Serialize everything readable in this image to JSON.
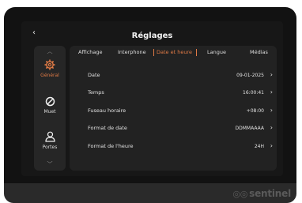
{
  "screen": {
    "title": "Réglages",
    "back_icon": "chevron-left-icon"
  },
  "sidebar": {
    "items": [
      {
        "label": "Général",
        "icon": "gear-icon",
        "active": true
      },
      {
        "label": "Muet",
        "icon": "mute-icon",
        "active": false
      },
      {
        "label": "Portes",
        "icon": "user-icon",
        "active": false
      }
    ]
  },
  "tabs": [
    {
      "label": "Affichage",
      "active": false
    },
    {
      "label": "Interphone",
      "active": false
    },
    {
      "label": "Date et heure",
      "active": true
    },
    {
      "label": "Langue",
      "active": false
    },
    {
      "label": "Médias",
      "active": false
    }
  ],
  "settings": [
    {
      "label": "Date",
      "value": "09-01-2025"
    },
    {
      "label": "Temps",
      "value": "16:00:41"
    },
    {
      "label": "Fuseau horaire",
      "value": "+08:00"
    },
    {
      "label": "Format de date",
      "value": "DDMMAAAA"
    },
    {
      "label": "Format de l'heure",
      "value": "24H"
    }
  ],
  "brand": {
    "name": "sentinel"
  },
  "colors": {
    "accent": "#e07a45",
    "background": "#171717",
    "panel": "#222222"
  }
}
